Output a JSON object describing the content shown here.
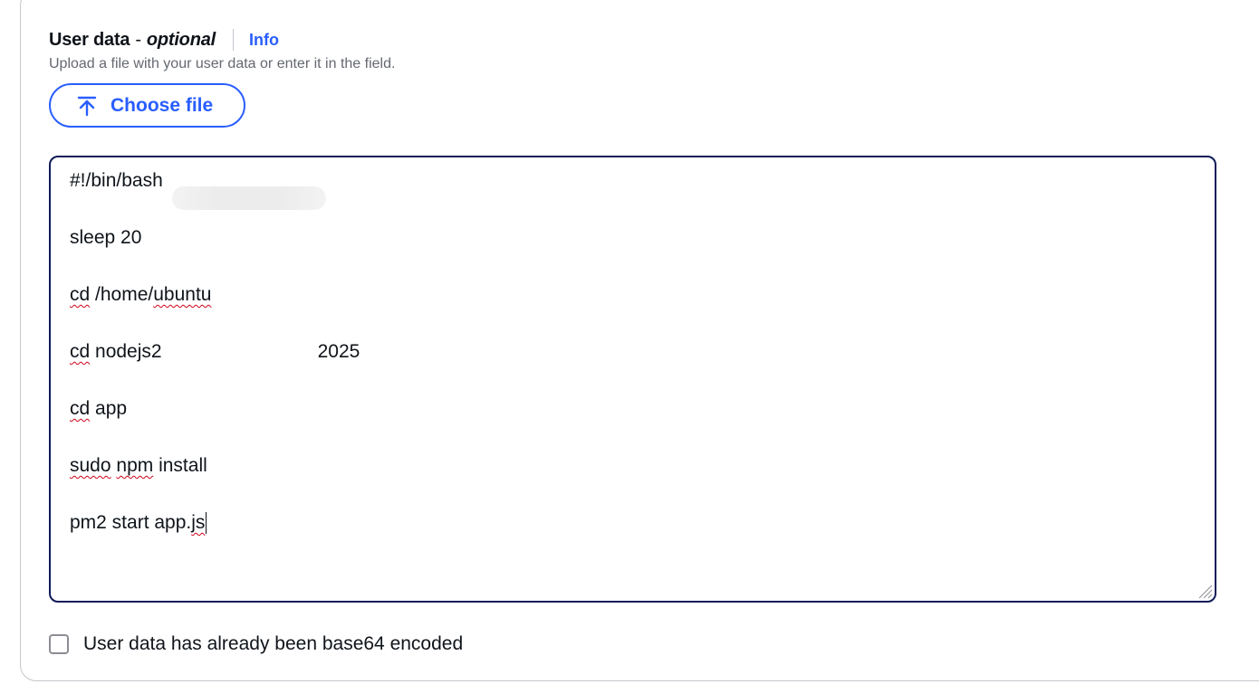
{
  "field": {
    "label": "User data",
    "separator": "-",
    "optional": "optional",
    "info_link": "Info",
    "description": "Upload a file with your user data or enter it in the field."
  },
  "choose_file": {
    "label": "Choose file",
    "icon": "upload-icon"
  },
  "user_data": {
    "lines": [
      "#!/bin/bash",
      "sleep 20",
      "cd /home/ubuntu",
      "cd nodejs2",
      "2025",
      "cd app",
      "sudo npm install",
      "pm2 start app.js"
    ],
    "tokens": {
      "l1": "#!/bin/bash",
      "l2": "sleep 20",
      "l3_a": "cd",
      "l3_b": " /home/",
      "l3_c": "ubuntu",
      "l4_a": "cd",
      "l4_b": " nodejs2",
      "l4_c": "2025",
      "l5_a": "cd",
      "l5_b": " app",
      "l6_a": "sudo",
      "l6_b": " ",
      "l6_c": "npm",
      "l6_d": " install",
      "l7_a": "pm2 start app.",
      "l7_b": "js"
    }
  },
  "base64_checkbox": {
    "label": "User data has already been base64 encoded",
    "checked": false
  },
  "colors": {
    "accent": "#295eff",
    "text": "#0f141a",
    "secondary_text": "#656871",
    "textarea_border": "#0f1b58",
    "spellcheck": "#d0021b"
  }
}
